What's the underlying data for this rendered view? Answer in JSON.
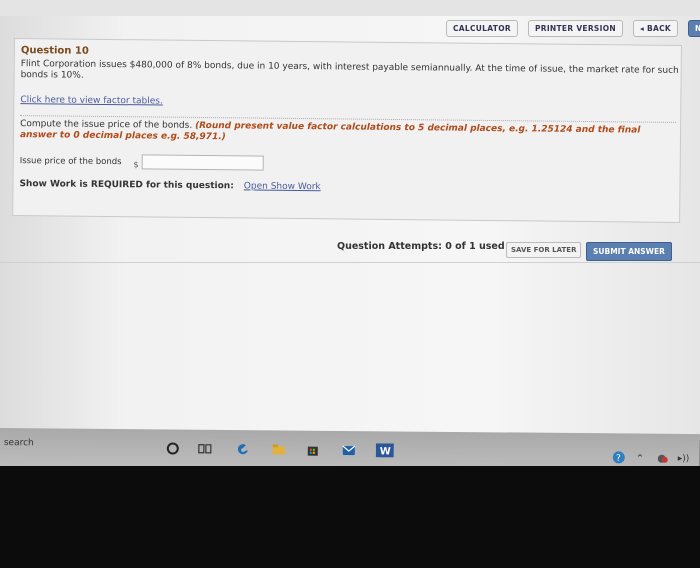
{
  "toolbar": {
    "calculator": "CALCULATOR",
    "printer_version": "PRINTER VERSION",
    "back": "◂ BACK",
    "next": "NEXT ▸"
  },
  "question": {
    "title": "Question 10",
    "text": "Flint Corporation issues $480,000 of 8% bonds, due in 10 years, with interest payable semiannually. At the time of issue, the market rate for such bonds is 10%.",
    "factor_link": "Click here to view factor tables.",
    "instruction_plain": "Compute the issue price of the bonds.",
    "instruction_emph": "(Round present value factor calculations to 5 decimal places, e.g. 1.25124 and the final answer to 0 decimal places e.g. 58,971.)",
    "issue_label": "Issue price of the bonds",
    "currency": "$",
    "issue_value": "",
    "show_work_label": "Show Work is REQUIRED for this question:",
    "show_work_link": "Open Show Work"
  },
  "footer": {
    "attempts": "Question Attempts: 0 of 1 used",
    "save_later": "SAVE FOR LATER",
    "submit": "SUBMIT ANSWER"
  },
  "taskbar": {
    "search": "search",
    "icons": [
      "cortana-icon",
      "task-view-icon",
      "edge-icon",
      "file-explorer-icon",
      "store-icon",
      "mail-icon",
      "word-icon"
    ],
    "tray_icons": [
      "help-icon",
      "chevron-up-icon",
      "cloud-icon",
      "speaker-icon"
    ]
  },
  "colors": {
    "accent_button": "#5a7fb0",
    "question_title": "#7a4a1a",
    "emphasis": "#b04a18",
    "link": "#4a5a9a"
  }
}
